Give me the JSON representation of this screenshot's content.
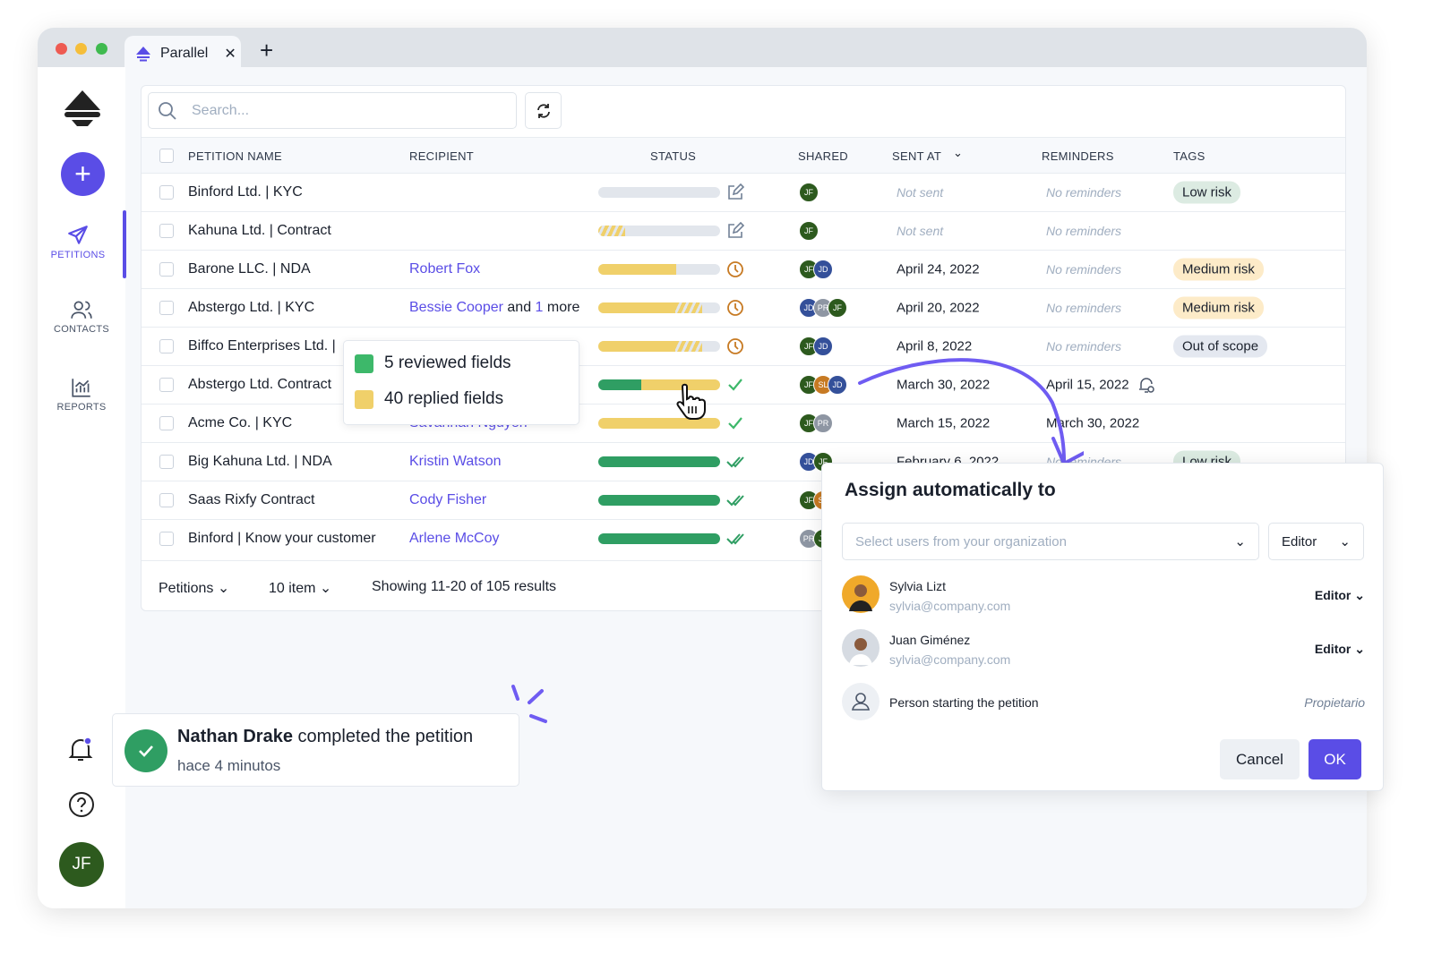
{
  "browser": {
    "tab_title": "Parallel"
  },
  "sidebar": {
    "items": [
      {
        "label": "PETITIONS",
        "icon": "paper-plane-icon",
        "active": true
      },
      {
        "label": "CONTACTS",
        "icon": "users-icon"
      },
      {
        "label": "REPORTS",
        "icon": "chart-icon"
      }
    ],
    "avatar": "JF"
  },
  "search": {
    "placeholder": "Search..."
  },
  "table": {
    "headers": [
      "PETITION NAME",
      "RECIPIENT",
      "STATUS",
      "SHARED",
      "SENT AT",
      "REMINDERS",
      "TAGS"
    ],
    "rows": [
      {
        "name": "Binford Ltd. | KYC",
        "recipient": "",
        "bar": [
          [
            "empty",
            0
          ]
        ],
        "icon": "edit",
        "shared": [
          "JF"
        ],
        "sent": "Not sent",
        "reminders": "No reminders",
        "tag": "Low risk",
        "tagType": "low"
      },
      {
        "name": "Kahuna Ltd. | Contract",
        "recipient": "",
        "bar": [
          [
            "stripe",
            0.22
          ]
        ],
        "icon": "edit",
        "shared": [
          "JF"
        ],
        "sent": "Not sent",
        "reminders": "No reminders",
        "tag": "",
        "tagType": ""
      },
      {
        "name": "Barone LLC. | NDA",
        "recipient": "Robert Fox",
        "bar": [
          [
            "yellow",
            0.64
          ]
        ],
        "icon": "clock",
        "shared": [
          "JF",
          "JD"
        ],
        "sent": "April 24, 2022",
        "reminders": "No reminders",
        "tag": "Medium risk",
        "tagType": "med"
      },
      {
        "name": "Abstergo Ltd. | KYC",
        "recipient": "Bessie Cooper",
        "recipient_extra": " and ",
        "recipient_more": "1",
        "recipient_tail": " more",
        "bar": [
          [
            "yellow",
            0.63
          ],
          [
            "stripe",
            0.22
          ]
        ],
        "icon": "clock",
        "shared": [
          "JD",
          "PR",
          "JF"
        ],
        "sent": "April 20, 2022",
        "reminders": "No reminders",
        "tag": "Medium risk",
        "tagType": "med"
      },
      {
        "name": "Biffco Enterprises Ltd. |",
        "recipient": "",
        "bar": [
          [
            "yellow",
            0.63
          ],
          [
            "stripe",
            0.22
          ]
        ],
        "icon": "clock",
        "shared": [
          "JF",
          "JD"
        ],
        "sent": "April 8, 2022",
        "reminders": "No reminders",
        "tag": "Out of scope",
        "tagType": "out"
      },
      {
        "name": "Abstergo Ltd. Contract",
        "recipient": "",
        "bar": [
          [
            "green",
            0.35
          ],
          [
            "yellow",
            0.65
          ]
        ],
        "icon": "check",
        "shared": [
          "JF",
          "SL",
          "JD"
        ],
        "sent": "March 30, 2022",
        "reminders": "April 15, 2022",
        "bell": true,
        "tag": "",
        "tagType": ""
      },
      {
        "name": "Acme Co. | KYC",
        "recipient": "Savannah Nguyen",
        "bar": [
          [
            "yellow",
            1
          ]
        ],
        "icon": "check",
        "shared": [
          "JF",
          "PR"
        ],
        "sent": "March 15, 2022",
        "reminders": "March 30, 2022",
        "tag": "",
        "tagType": ""
      },
      {
        "name": "Big Kahuna Ltd. | NDA",
        "recipient": "Kristin Watson",
        "bar": [
          [
            "green",
            1
          ]
        ],
        "icon": "double-check",
        "shared": [
          "JD",
          "JF"
        ],
        "sent": "February 6, 2022",
        "reminders": "No reminders",
        "tag": "Low risk",
        "tagType": "low"
      },
      {
        "name": "Saas Rixfy Contract",
        "recipient": "Cody Fisher",
        "bar": [
          [
            "green",
            1
          ]
        ],
        "icon": "double-check",
        "shared": [
          "JF",
          "SL"
        ],
        "sent": "",
        "reminders": "",
        "tag": "",
        "tagType": ""
      },
      {
        "name": "Binford | Know your customer",
        "recipient": "Arlene McCoy",
        "bar": [
          [
            "green",
            1
          ]
        ],
        "icon": "double-check",
        "shared": [
          "PR",
          "JF"
        ],
        "sent": "",
        "reminders": "",
        "tag": "",
        "tagType": ""
      }
    ]
  },
  "footer": {
    "type": "Petitions",
    "per_page": "10 item",
    "results": "Showing 11-20 of 105 results"
  },
  "tooltip": {
    "reviewed": "5 reviewed fields",
    "replied": "40 replied fields"
  },
  "toast": {
    "name": "Nathan Drake",
    "message": " completed the petition",
    "time": "hace 4 minutos"
  },
  "dialog": {
    "title": "Assign automatically to",
    "placeholder": "Select users from your organization",
    "role": "Editor",
    "users": [
      {
        "name": "Sylvia Lizt",
        "email": "sylvia@company.com",
        "role": "Editor"
      },
      {
        "name": "Juan Giménez",
        "email": "sylvia@company.com",
        "role": "Editor"
      },
      {
        "name": "Person starting the petition",
        "role": "Propietario"
      }
    ],
    "cancel": "Cancel",
    "ok": "OK"
  },
  "colors": {
    "accent": "#5a4de6",
    "green": "#2f9e63",
    "yellow": "#f0d06a",
    "JF": "#2d5a1e",
    "JD": "#34509a",
    "PR": "#8e96a3",
    "SL": "#c77a23"
  }
}
